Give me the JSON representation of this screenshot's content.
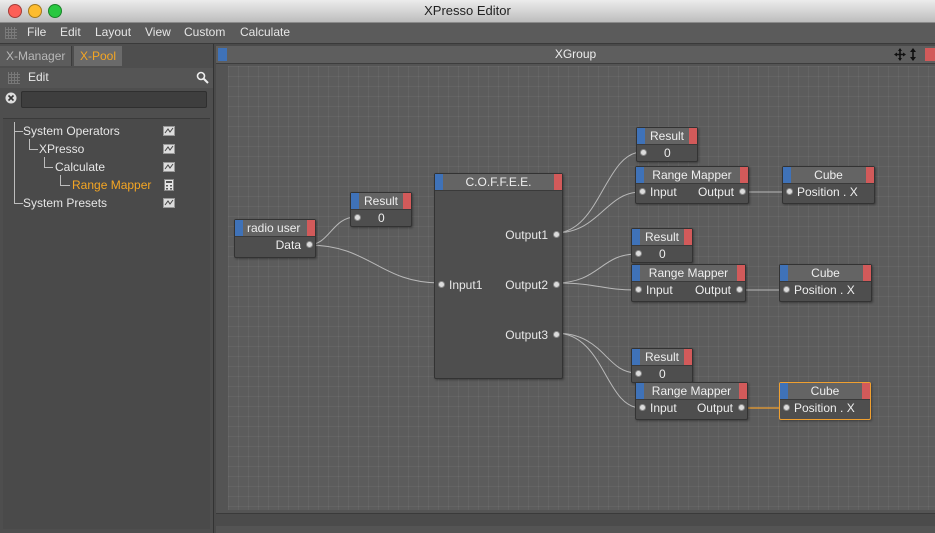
{
  "window": {
    "title": "XPresso Editor"
  },
  "menu": [
    "File",
    "Edit",
    "Layout",
    "View",
    "Custom",
    "Calculate"
  ],
  "left_panel": {
    "tabs": [
      "X-Manager",
      "X-Pool"
    ],
    "toolbar_label": "Edit",
    "search_value": "",
    "tree": [
      {
        "label": "System Operators"
      },
      {
        "label": "XPresso"
      },
      {
        "label": "Calculate"
      },
      {
        "label": "Range Mapper"
      },
      {
        "label": "System Presets"
      }
    ]
  },
  "graph": {
    "title": "XGroup",
    "nodes": {
      "radio_user": {
        "title": "radio user",
        "port": "Data"
      },
      "result_a": {
        "title": "Result",
        "value": "0"
      },
      "coffee": {
        "title": "C.O.F.F.E.E.",
        "input": "Input1",
        "outputs": [
          "Output1",
          "Output2",
          "Output3"
        ]
      },
      "result_1": {
        "title": "Result",
        "value": "0"
      },
      "mapper_1": {
        "title": "Range Mapper",
        "input": "Input",
        "output": "Output"
      },
      "cube_1": {
        "title": "Cube",
        "port": "Position . X"
      },
      "result_2": {
        "title": "Result",
        "value": "0"
      },
      "mapper_2": {
        "title": "Range Mapper",
        "input": "Input",
        "output": "Output"
      },
      "cube_2": {
        "title": "Cube",
        "port": "Position . X"
      },
      "result_3": {
        "title": "Result",
        "value": "0"
      },
      "mapper_3": {
        "title": "Range Mapper",
        "input": "Input",
        "output": "Output"
      },
      "cube_3": {
        "title": "Cube",
        "port": "Position . X"
      }
    }
  },
  "colors": {
    "accent": "#f5a623",
    "input_port_bar": "#3f72b8",
    "output_port_bar": "#d25a5a",
    "selected_wire": "#f0a030"
  }
}
